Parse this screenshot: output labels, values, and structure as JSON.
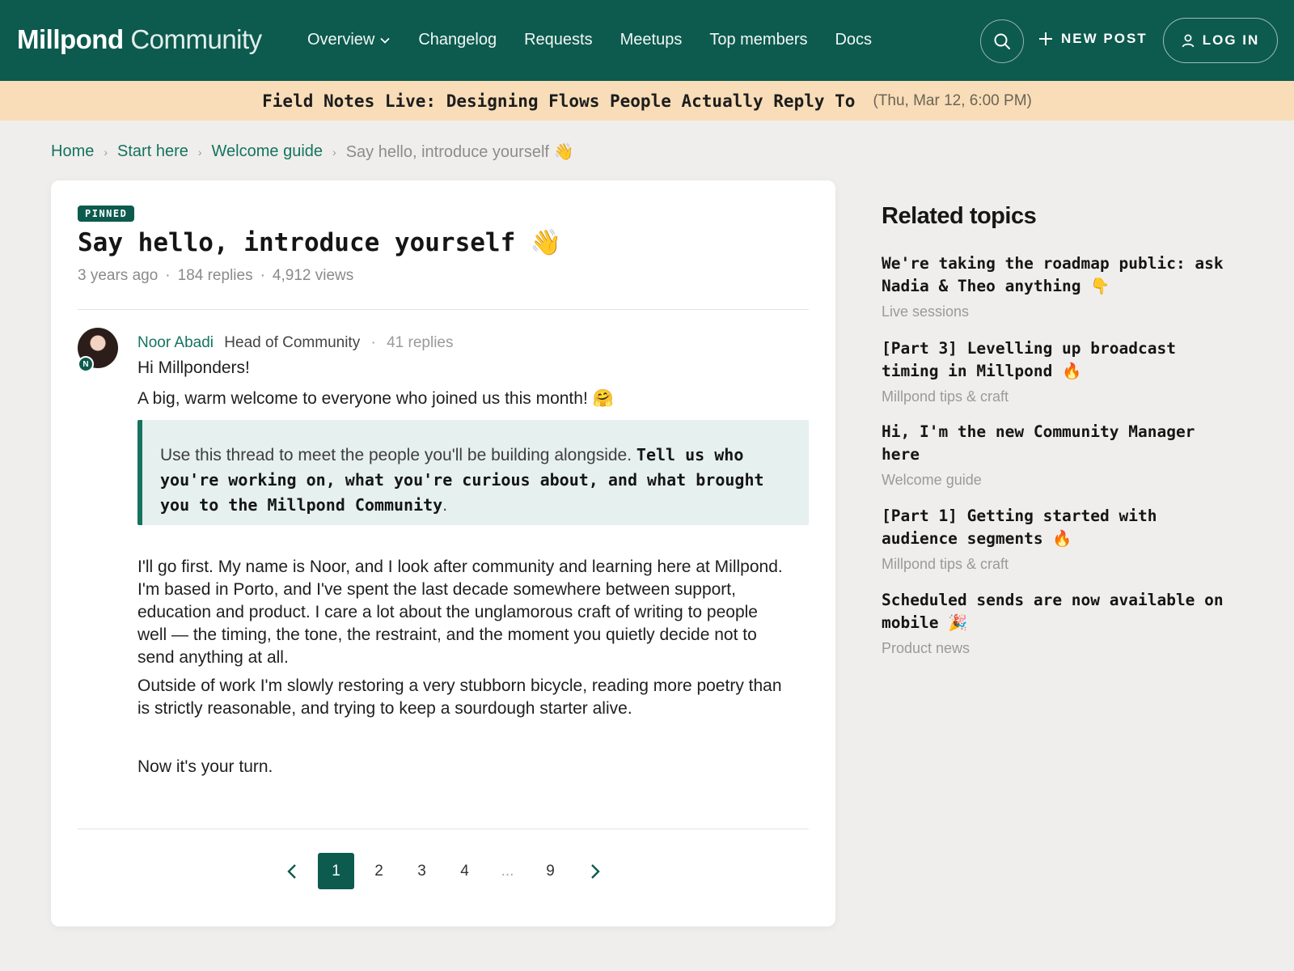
{
  "header": {
    "brand_bold": "Millpond",
    "brand_light": "Community",
    "nav": [
      "Overview",
      "Changelog",
      "Requests",
      "Meetups",
      "Top members",
      "Docs"
    ],
    "new_post": "NEW POST",
    "login": "LOG IN"
  },
  "announcement": {
    "title": "Field Notes Live: Designing Flows People Actually Reply To",
    "when": "(Thu, Mar 12, 6:00 PM)"
  },
  "breadcrumb": {
    "items": [
      "Home",
      "Start here",
      "Welcome guide"
    ],
    "current": "Say hello, introduce yourself 👋"
  },
  "post": {
    "badge": "PINNED",
    "title": "Say hello, introduce yourself 👋",
    "age": "3 years ago",
    "replies": "184 replies",
    "views": "4,912 views",
    "author": {
      "initial": "N",
      "name": "Noor Abadi",
      "role": "Head of Community",
      "reply_count": "41 replies"
    },
    "greeting": "Hi Millponders!",
    "welcome": "A big, warm welcome to everyone who joined us this month! 🤗",
    "quote_plain": "Use this thread to meet the people you'll be building alongside. ",
    "quote_bold": "Tell us who you're working on, what you're curious about, and what brought you to the Millpond Community",
    "quote_end": ".",
    "para1": "I'll go first. My name is Noor, and I look after community and learning here at Millpond. I'm based in Porto, and I've spent the last decade somewhere between support, education and product. I care a lot about the unglamorous craft of writing to people well — the timing, the tone, the restraint, and the moment you quietly decide not to send anything at all.",
    "para2": "Outside of work I'm slowly restoring a very stubborn bicycle, reading more poetry than is strictly reasonable, and trying to keep a sourdough starter alive.",
    "para3": "Now it's your turn."
  },
  "pagination": {
    "pages": [
      "1",
      "2",
      "3",
      "4",
      "...",
      "9"
    ],
    "current": "1"
  },
  "sidebar": {
    "heading": "Related topics",
    "topics": [
      {
        "title": "We're taking the roadmap public: ask Nadia & Theo anything 👇",
        "category": "Live sessions"
      },
      {
        "title": "[Part 3] Levelling up broadcast timing in Millpond 🔥",
        "category": "Millpond tips & craft"
      },
      {
        "title": "Hi, I'm the new Community Manager here",
        "category": "Welcome guide"
      },
      {
        "title": "[Part 1] Getting started with audience segments 🔥",
        "category": "Millpond tips & craft"
      },
      {
        "title": "Scheduled sends are now available on mobile 🎉",
        "category": "Product news"
      }
    ]
  },
  "colors": {
    "brand": "#0d5a4e",
    "banner": "#f8ddb8",
    "link": "#15735f"
  }
}
